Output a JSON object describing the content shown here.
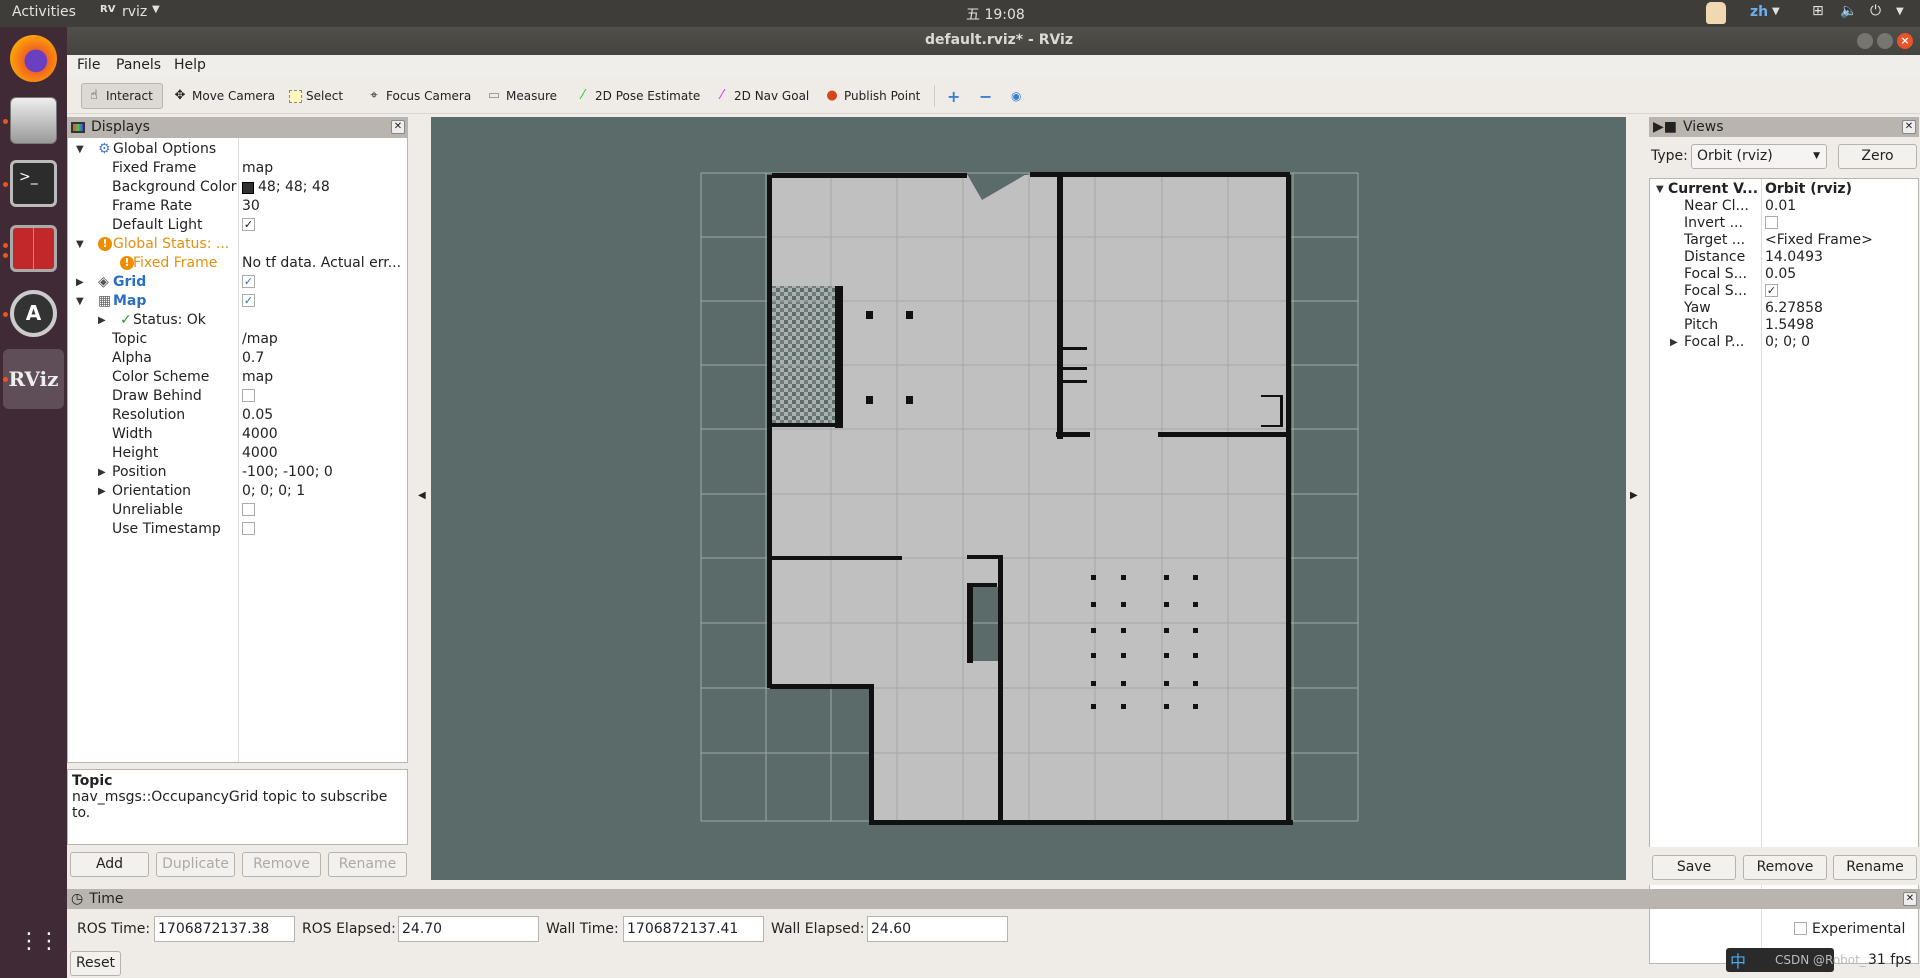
{
  "topbar": {
    "activities": "Activities",
    "app": "rviz",
    "clock": "五 19:08",
    "lang": "zh",
    "icons": [
      "cat-avatar-icon",
      "network-icon",
      "volume-icon",
      "power-icon"
    ]
  },
  "window": {
    "title": "default.rviz* - RViz"
  },
  "launcher": {
    "apps": [
      "firefox",
      "files",
      "terminal",
      "terminator",
      "software-updater",
      "rviz"
    ]
  },
  "menu": [
    "File",
    "Panels",
    "Help"
  ],
  "toolbar": {
    "tools": [
      "Interact",
      "Move Camera",
      "Select",
      "Focus Camera",
      "Measure",
      "2D Pose Estimate",
      "2D Nav Goal",
      "Publish Point"
    ],
    "active": "Interact"
  },
  "displays": {
    "title": "Displays",
    "rows": [
      {
        "label": "Global Options",
        "value": ""
      },
      {
        "label": "Fixed Frame",
        "value": "map"
      },
      {
        "label": "Background Color",
        "value": "48; 48; 48"
      },
      {
        "label": "Frame Rate",
        "value": "30"
      },
      {
        "label": "Default Light",
        "value": ""
      },
      {
        "label": "Global Status: ...",
        "value": ""
      },
      {
        "label": "Fixed Frame",
        "value": "No tf data.  Actual err..."
      },
      {
        "label": "Grid",
        "value": ""
      },
      {
        "label": "Map",
        "value": ""
      },
      {
        "label": "Status: Ok",
        "value": ""
      },
      {
        "label": "Topic",
        "value": "/map"
      },
      {
        "label": "Alpha",
        "value": "0.7"
      },
      {
        "label": "Color Scheme",
        "value": "map"
      },
      {
        "label": "Draw Behind",
        "value": ""
      },
      {
        "label": "Resolution",
        "value": "0.05"
      },
      {
        "label": "Width",
        "value": "4000"
      },
      {
        "label": "Height",
        "value": "4000"
      },
      {
        "label": "Position",
        "value": "-100; -100; 0"
      },
      {
        "label": "Orientation",
        "value": "0; 0; 0; 1"
      },
      {
        "label": "Unreliable",
        "value": ""
      },
      {
        "label": "Use Timestamp",
        "value": ""
      }
    ],
    "checks": {
      "default_light": true,
      "grid": true,
      "map": true,
      "draw_behind": false,
      "unreliable": false,
      "use_timestamp": false
    },
    "background_color": "#303030",
    "desc_title": "Topic",
    "desc_text": "nav_msgs::OccupancyGrid topic to subscribe to.",
    "buttons": [
      "Add",
      "Duplicate",
      "Remove",
      "Rename"
    ]
  },
  "views": {
    "title": "Views",
    "type_label": "Type:",
    "type_value": "Orbit (rviz)",
    "zero": "Zero",
    "rows": [
      {
        "label": "Current V...",
        "value": "Orbit (rviz)"
      },
      {
        "label": "Near Cl...",
        "value": "0.01"
      },
      {
        "label": "Invert ...",
        "value": ""
      },
      {
        "label": "Target ...",
        "value": "<Fixed Frame>"
      },
      {
        "label": "Distance",
        "value": "14.0493"
      },
      {
        "label": "Focal S...",
        "value": "0.05"
      },
      {
        "label": "Focal S...",
        "value": ""
      },
      {
        "label": "Yaw",
        "value": "6.27858"
      },
      {
        "label": "Pitch",
        "value": "1.5498"
      },
      {
        "label": "Focal P...",
        "value": "0; 0; 0"
      }
    ],
    "buttons": [
      "Save",
      "Remove",
      "Rename"
    ]
  },
  "time": {
    "title": "Time",
    "ros_time_label": "ROS Time:",
    "ros_time": "1706872137.38",
    "ros_elapsed_label": "ROS Elapsed:",
    "ros_elapsed": "24.70",
    "wall_time_label": "Wall Time:",
    "wall_time": "1706872137.41",
    "wall_elapsed_label": "Wall Elapsed:",
    "wall_elapsed": "24.60",
    "experimental": "Experimental",
    "reset": "Reset",
    "fps": "31 fps",
    "ime": "中",
    "watermark": "CSDN @Robot_"
  },
  "colors": {
    "viewport": "#5a6b69",
    "map_free": "#c0c0c0",
    "map_wall": "#111111",
    "accent": "#e95420"
  }
}
